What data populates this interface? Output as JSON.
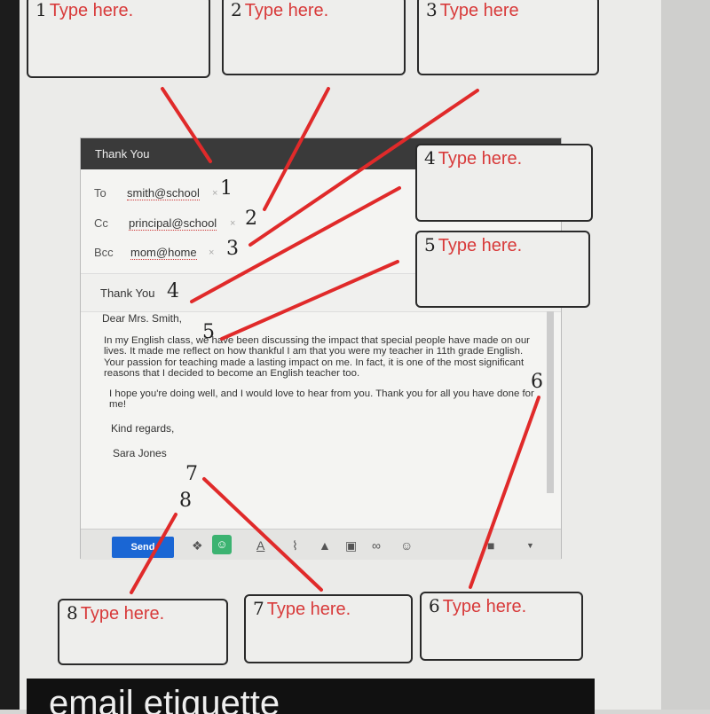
{
  "boxes": [
    {
      "num": "1",
      "placeholder": "Type here."
    },
    {
      "num": "2",
      "placeholder": "Type here."
    },
    {
      "num": "3",
      "placeholder": "Type here"
    },
    {
      "num": "4",
      "placeholder": "Type here."
    },
    {
      "num": "5",
      "placeholder": "Type here."
    },
    {
      "num": "8",
      "placeholder": "Type here."
    },
    {
      "num": "7",
      "placeholder": "Type here."
    },
    {
      "num": "6",
      "placeholder": "Type here."
    }
  ],
  "email": {
    "title": "Thank You",
    "to_label": "To",
    "to": "smith@school",
    "cc_label": "Cc",
    "cc": "principal@school",
    "bcc_label": "Bcc",
    "bcc": "mom@home",
    "subject": "Thank You",
    "greeting": "Dear Mrs. Smith,",
    "para1": "In my English class, we have been discussing the impact that special people have made on our lives. It made me reflect on how thankful I am that you were my teacher in 11th grade English. Your passion for teaching made a lasting impact on me. In fact, it is one of the most significant reasons that I decided to become an English teacher too.",
    "para2": "I hope you're doing well, and I would love to hear from you. Thank you for all you have done for me!",
    "closing": "Kind regards,",
    "signature": "Sara Jones",
    "send_label": "Send",
    "remove_glyph": "×"
  },
  "marks": [
    "1",
    "2",
    "3",
    "4",
    "5",
    "6",
    "7",
    "8"
  ],
  "banner": "email etiquette",
  "colors": {
    "accent": "#d83a3a",
    "send": "#1a66d4",
    "header": "#3a3a3a"
  }
}
